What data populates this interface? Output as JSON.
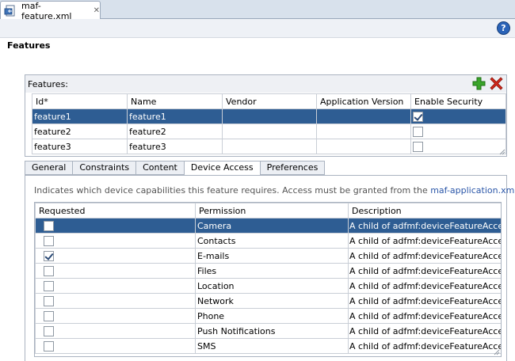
{
  "editor_tab": {
    "filename": "maf-feature.xml",
    "close": "✕"
  },
  "help": {
    "label": "?"
  },
  "section_title": "Features",
  "features": {
    "label": "Features:",
    "columns": [
      "Id*",
      "Name",
      "Vendor",
      "Application Version",
      "Enable Security"
    ],
    "rows": [
      {
        "id": "feature1",
        "name": "feature1",
        "vendor": "",
        "version": "",
        "security": true,
        "selected": true
      },
      {
        "id": "feature2",
        "name": "feature2",
        "vendor": "",
        "version": "",
        "security": false,
        "selected": false
      },
      {
        "id": "feature3",
        "name": "feature3",
        "vendor": "",
        "version": "",
        "security": false,
        "selected": false
      }
    ]
  },
  "subtabs": [
    "General",
    "Constraints",
    "Content",
    "Device Access",
    "Preferences"
  ],
  "active_subtab": "Device Access",
  "info": {
    "text": "Indicates which device capabilities this feature requires. Access must be granted from the ",
    "link": "maf-application.xml",
    "suffix": "."
  },
  "permissions": {
    "columns": [
      "Requested",
      "Permission",
      "Description"
    ],
    "rows": [
      {
        "requested": false,
        "permission": "Camera",
        "description": "A child of adfmf:deviceFeatureAcces...",
        "selected": true
      },
      {
        "requested": false,
        "permission": "Contacts",
        "description": "A child of adfmf:deviceFeatureAcces...",
        "selected": false
      },
      {
        "requested": true,
        "permission": "E-mails",
        "description": "A child of adfmf:deviceFeatureAcces...",
        "selected": false
      },
      {
        "requested": false,
        "permission": "Files",
        "description": "A child of adfmf:deviceFeatureAcces...",
        "selected": false
      },
      {
        "requested": false,
        "permission": "Location",
        "description": "A child of adfmf:deviceFeatureAcces...",
        "selected": false
      },
      {
        "requested": false,
        "permission": "Network",
        "description": "A child of adfmf:deviceFeatureAcces...",
        "selected": false
      },
      {
        "requested": false,
        "permission": "Phone",
        "description": "A child of adfmf:deviceFeatureAcces...",
        "selected": false
      },
      {
        "requested": false,
        "permission": "Push Notifications",
        "description": "A child of adfmf:deviceFeatureAcces...",
        "selected": false
      },
      {
        "requested": false,
        "permission": "SMS",
        "description": "A child of adfmf:deviceFeatureAcces...",
        "selected": false
      }
    ]
  },
  "colors": {
    "selection": "#2e5d93",
    "add": "#3aa52a",
    "delete": "#d0281c",
    "link": "#2a56a8"
  }
}
